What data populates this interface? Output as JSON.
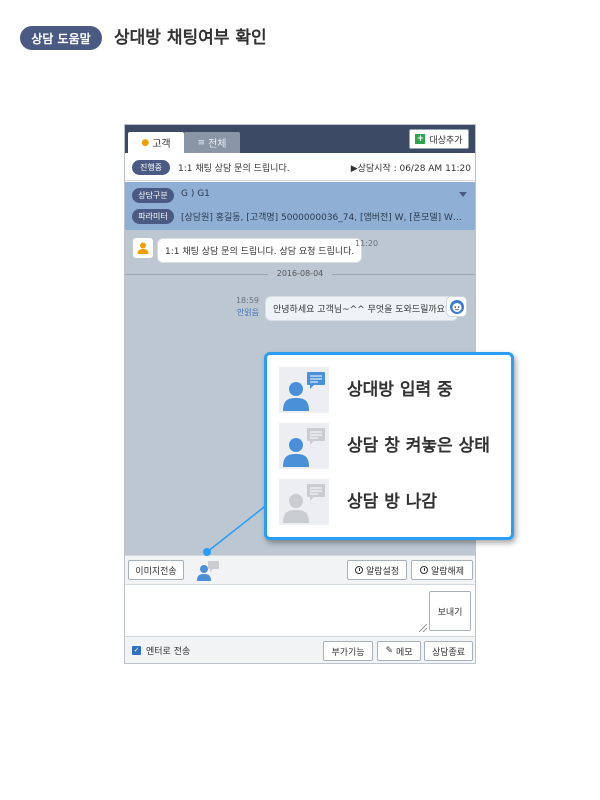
{
  "header": {
    "badge": "상담 도움말",
    "title": "상대방 채팅여부 확인"
  },
  "window": {
    "tabs": [
      {
        "label": "고객",
        "icon": "person-icon",
        "active": true
      },
      {
        "label": "전체",
        "icon": "list-icon",
        "active": false
      }
    ],
    "add_target_label": "대상추가",
    "status": {
      "pill": "진행중",
      "text": "1:1 채팅 상담 문의 드립니다.",
      "start_time": "▶상담시작 : 06/28 AM 11:20"
    },
    "info": {
      "category_pill": "상담구분",
      "category_value": "G ) G1",
      "param_pill": "파라미터",
      "param_value": "[상담원] 홍길동, [고객명] 5000000036_74, [앱버전] W, [폰모델] W…"
    },
    "messages": [
      {
        "text": "1:1 채팅 상담 문의 드립니다. 상담 요청 드립니다.",
        "time": "11:20",
        "side": "customer"
      },
      {
        "text": "안녕하세요 고객님~^^ 무엇을 도와드릴까요?",
        "time": "18:59",
        "read_status": "안읽음",
        "side": "agent"
      }
    ],
    "date_separator": "2016-08-04",
    "toolbar": {
      "image_send": "이미지전송",
      "alarm_set": "알람설정",
      "alarm_off": "알람해제"
    },
    "send_label": "보내기",
    "bottom": {
      "enter_send": "엔터로 전송",
      "extra": "부가기능",
      "memo": "메모",
      "end": "상담종료"
    }
  },
  "legend": {
    "items": [
      {
        "label": "상대방 입력 중",
        "state": "typing"
      },
      {
        "label": "상담 창 켜놓은 상태",
        "state": "open"
      },
      {
        "label": "상담 방 나감",
        "state": "left"
      }
    ]
  },
  "colors": {
    "accent": "#2a9df4",
    "badge": "#4a5a83",
    "topbar": "#3c4a66",
    "info_panel": "#8fb0d4",
    "chat_bg": "#bcc7d2",
    "user_icon_blue": "#4a90d9",
    "user_icon_gray": "#c9cdd2"
  }
}
